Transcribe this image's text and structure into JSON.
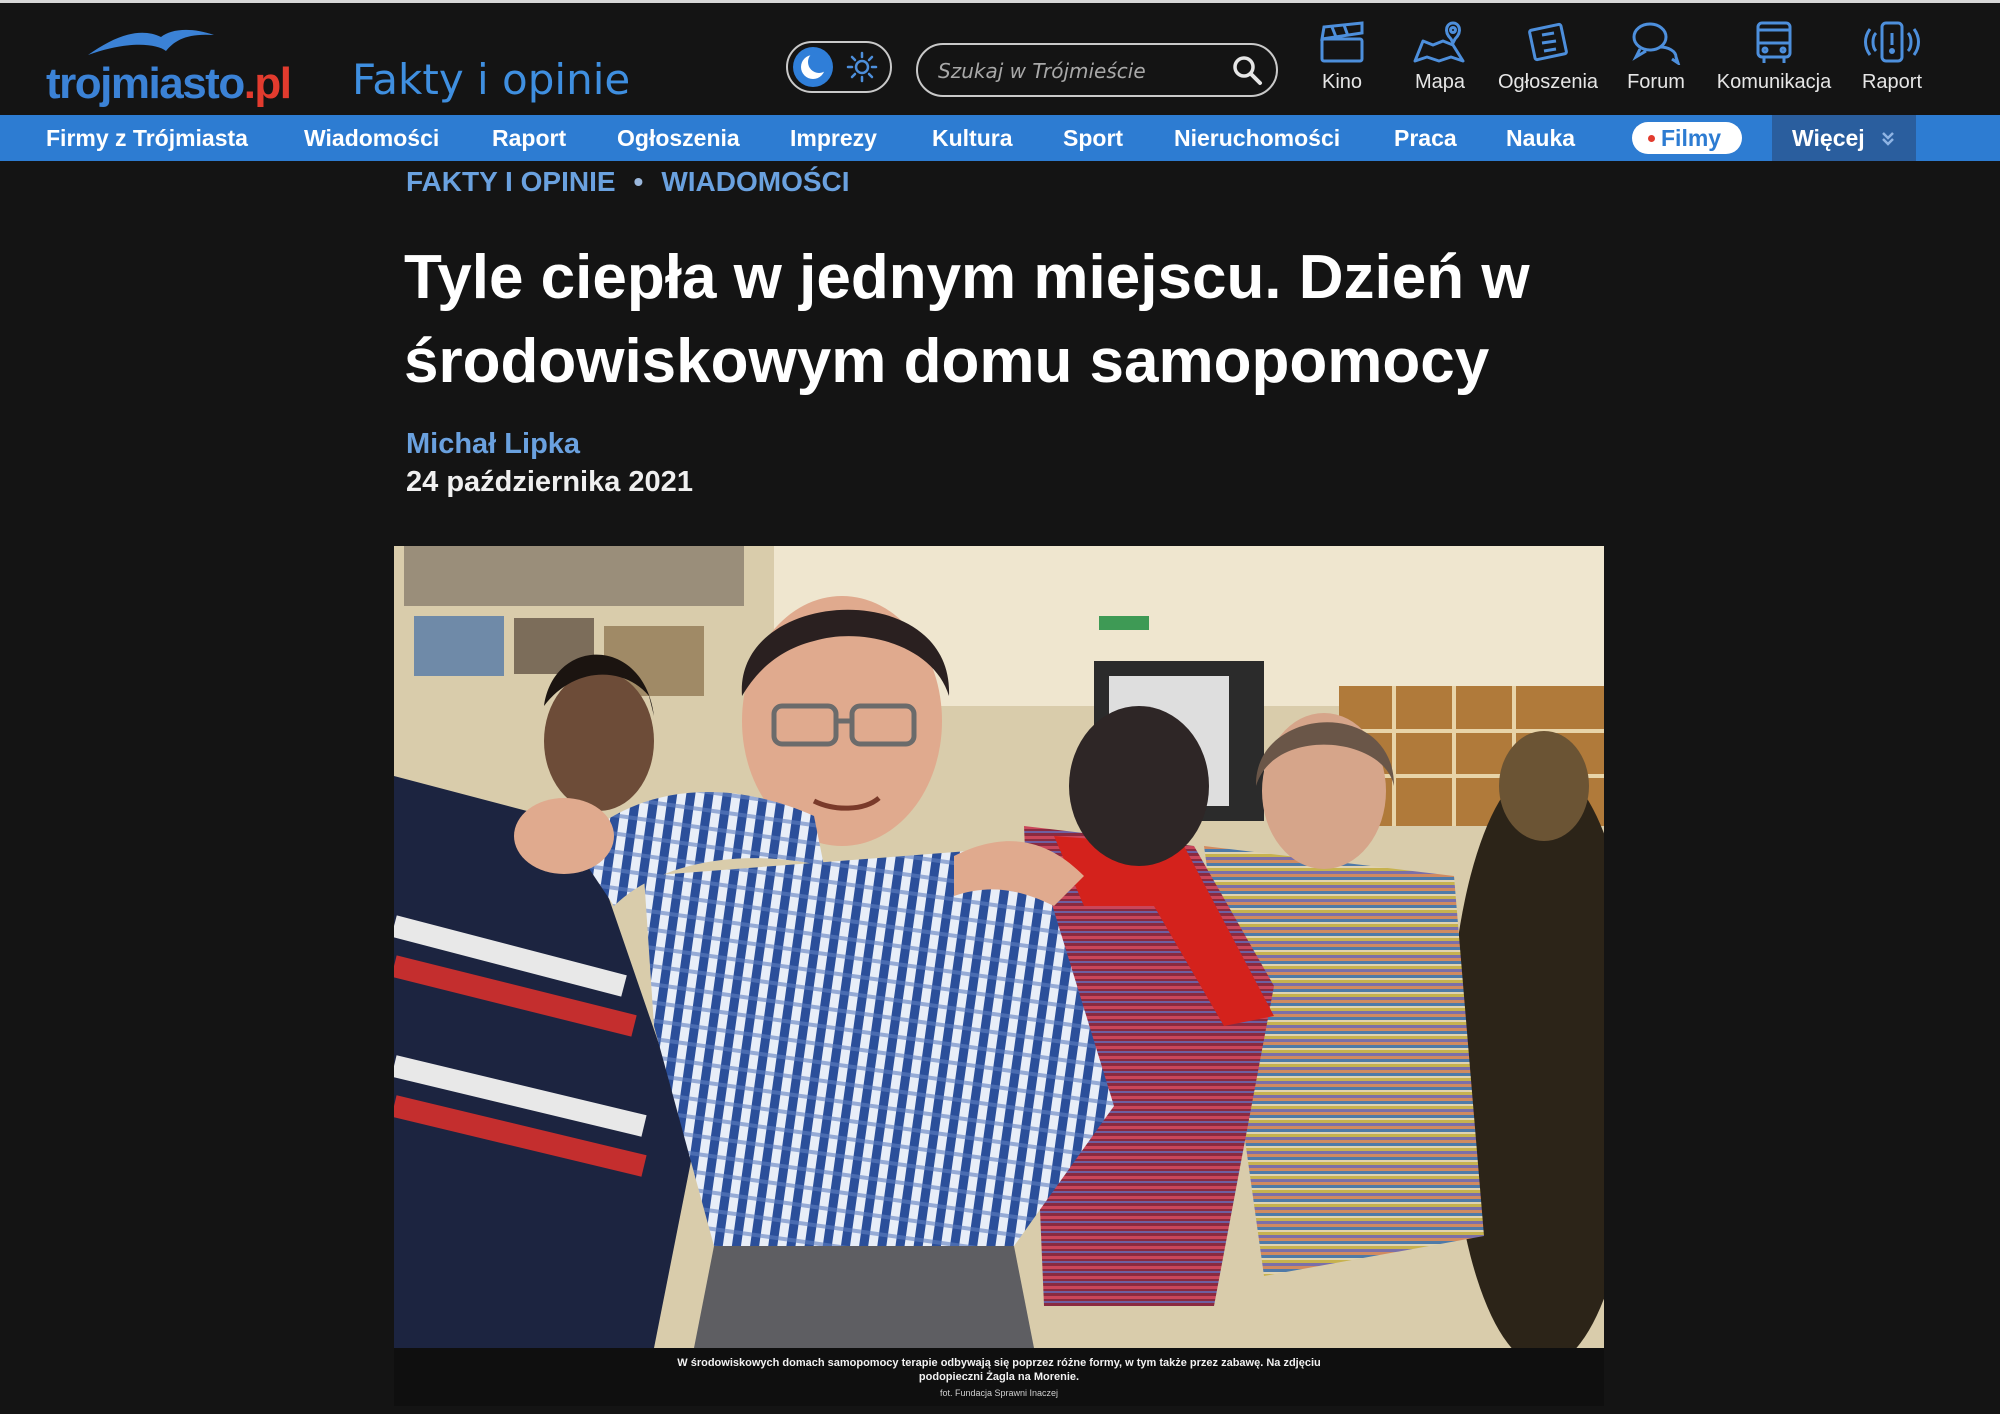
{
  "header": {
    "logo_text": "trojmiasto",
    "logo_suffix": ".pl",
    "section_title": "Fakty i opinie",
    "search_placeholder": "Szukaj w Trójmieście",
    "icons": [
      {
        "label": "Kino",
        "icon": "clapperboard-icon"
      },
      {
        "label": "Mapa",
        "icon": "map-icon"
      },
      {
        "label": "Ogłoszenia",
        "icon": "classifieds-icon"
      },
      {
        "label": "Forum",
        "icon": "forum-icon"
      },
      {
        "label": "Komunikacja",
        "icon": "bus-icon"
      },
      {
        "label": "Raport",
        "icon": "phone-alert-icon"
      }
    ]
  },
  "nav": {
    "items": [
      "Firmy z Trójmiasta",
      "Wiadomości",
      "Raport",
      "Ogłoszenia",
      "Imprezy",
      "Kultura",
      "Sport",
      "Nieruchomości",
      "Praca",
      "Nauka"
    ],
    "filmy": "Filmy",
    "more": "Więcej"
  },
  "article": {
    "breadcrumb": [
      "FAKTY I OPINIE",
      "WIADOMOŚCI"
    ],
    "breadcrumb_separator": "•",
    "title": "Tyle ciepła w jednym miejscu. Dzień w środowiskowym domu samopomocy",
    "author": "Michał Lipka",
    "date": "24 października 2021",
    "caption": "W środowiskowych domach samopomocy terapie odbywają się poprzez różne formy, w tym także przez zabawę. Na zdjęciu podopieczni Żagla na Morenie.",
    "credit": "fot. Fundacja Sprawni Inaczej"
  },
  "colors": {
    "accent": "#2d7cd2",
    "background": "#141414",
    "link": "#6aa1df",
    "logo_dot": "#e23b2e"
  }
}
